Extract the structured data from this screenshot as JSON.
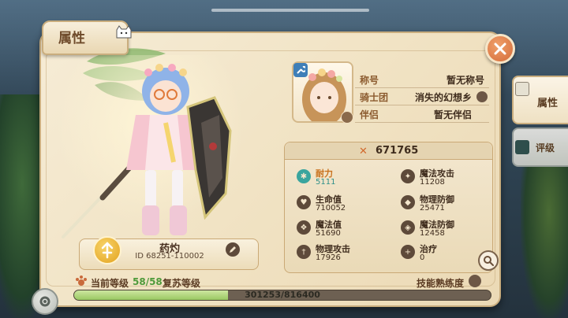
{
  "title": "属性",
  "side_tabs": [
    {
      "label": "属性",
      "icon": "card-icon",
      "active": true
    },
    {
      "label": "评级",
      "icon": "star-badge-icon",
      "active": false
    }
  ],
  "character": {
    "name": "药灼",
    "id_text": "ID 68251-110002"
  },
  "profile": {
    "rows": [
      {
        "key": "称号",
        "value": "暂无称号"
      },
      {
        "key": "骑士团",
        "value": "消失的幻想乡"
      },
      {
        "key": "伴侣",
        "value": "暂无伴侣"
      }
    ]
  },
  "power": "671765",
  "stats": [
    {
      "name": "耐力",
      "value": "5111",
      "icon": "snowflake-icon",
      "highlight": true
    },
    {
      "name": "魔法攻击",
      "value": "11208",
      "icon": "magic-attack-icon",
      "highlight": false
    },
    {
      "name": "生命值",
      "value": "710052",
      "icon": "heart-icon",
      "highlight": false
    },
    {
      "name": "物理防御",
      "value": "25471",
      "icon": "shield-icon",
      "highlight": false
    },
    {
      "name": "魔法值",
      "value": "51690",
      "icon": "mana-icon",
      "highlight": false
    },
    {
      "name": "魔法防御",
      "value": "12458",
      "icon": "magic-shield-icon",
      "highlight": false
    },
    {
      "name": "物理攻击",
      "value": "17926",
      "icon": "sword-icon",
      "highlight": false
    },
    {
      "name": "治疗",
      "value": "0",
      "icon": "plus-icon",
      "highlight": false
    }
  ],
  "level": {
    "label": "当前等级",
    "value": "58/58",
    "revive_label": "复苏等级"
  },
  "skill_label": "技能熟练度",
  "exp": {
    "text": "301253/816400",
    "fraction": 0.369
  },
  "colors": {
    "accent_orange": "#d46c3a",
    "highlight_teal": "#2f8f89",
    "level_green": "#4e9a3a",
    "parchment": "#f1e3c4"
  }
}
